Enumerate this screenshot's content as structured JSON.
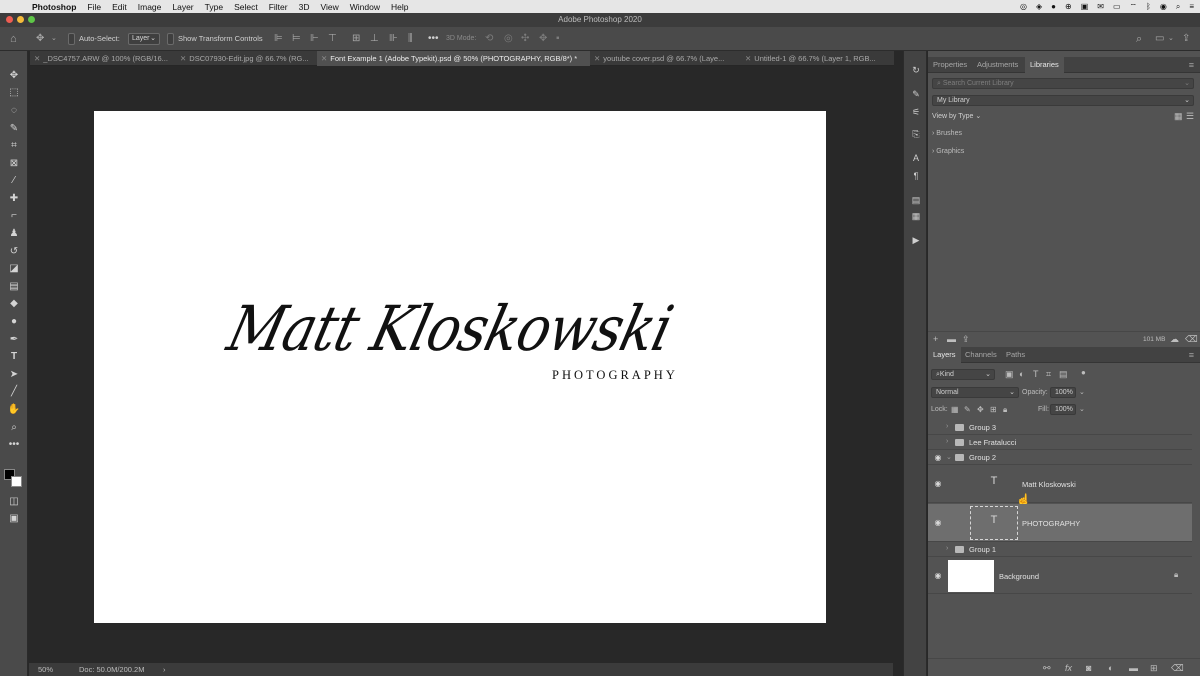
{
  "menubar": {
    "app_name": "Photoshop",
    "items": [
      "File",
      "Edit",
      "Image",
      "Layer",
      "Type",
      "Select",
      "Filter",
      "3D",
      "View",
      "Window",
      "Help"
    ],
    "apple_icon": "apple-icon"
  },
  "window": {
    "title": "Adobe Photoshop 2020"
  },
  "options_bar": {
    "auto_select_label": "Auto-Select:",
    "auto_select_value": "Layer",
    "transform_label": "Show Transform Controls",
    "mode_3d_label": "3D Mode:"
  },
  "doc_tabs": [
    {
      "label": "_DSC4757.ARW @ 100% (RGB/16..."
    },
    {
      "label": "DSC07930-Edit.jpg @ 66.7% (RG..."
    },
    {
      "label": "Font Example 1 (Adobe Typekit).psd @ 50% (PHOTOGRAPHY, RGB/8*) *"
    },
    {
      "label": "youtube cover.psd @ 66.7% (Laye..."
    },
    {
      "label": "Untitled-1 @ 66.7% (Layer 1, RGB..."
    }
  ],
  "canvas": {
    "script_text": "Matt Kloskowski",
    "sub_text": "PHOTOGRAPHY"
  },
  "status_bar": {
    "zoom": "50%",
    "doc_size": "Doc: 50.0M/200.2M",
    "arrow": "›"
  },
  "libraries_panel": {
    "tabs": [
      "Properties",
      "Adjustments",
      "Libraries"
    ],
    "search_placeholder": "Search Current Library",
    "library_name": "My Library",
    "view_by": "View by Type",
    "sections": [
      "Brushes",
      "Graphics"
    ],
    "storage": "101 MB"
  },
  "layers_panel": {
    "tabs": [
      "Layers",
      "Channels",
      "Paths"
    ],
    "filter_kind": "Kind",
    "blend_mode": "Normal",
    "opacity_label": "Opacity:",
    "opacity_value": "100%",
    "lock_label": "Lock:",
    "fill_label": "Fill:",
    "fill_value": "100%",
    "layers": [
      {
        "name": "Group 3"
      },
      {
        "name": "Lee Fratalucci"
      },
      {
        "name": "Group 2"
      },
      {
        "name": "Matt Kloskowski"
      },
      {
        "name": "PHOTOGRAPHY"
      },
      {
        "name": "Group 1"
      },
      {
        "name": "Background"
      }
    ]
  },
  "colors": {
    "panel_bg": "#535353",
    "canvas_bg": "#282828",
    "selected_layer": "#6e6e6e"
  }
}
